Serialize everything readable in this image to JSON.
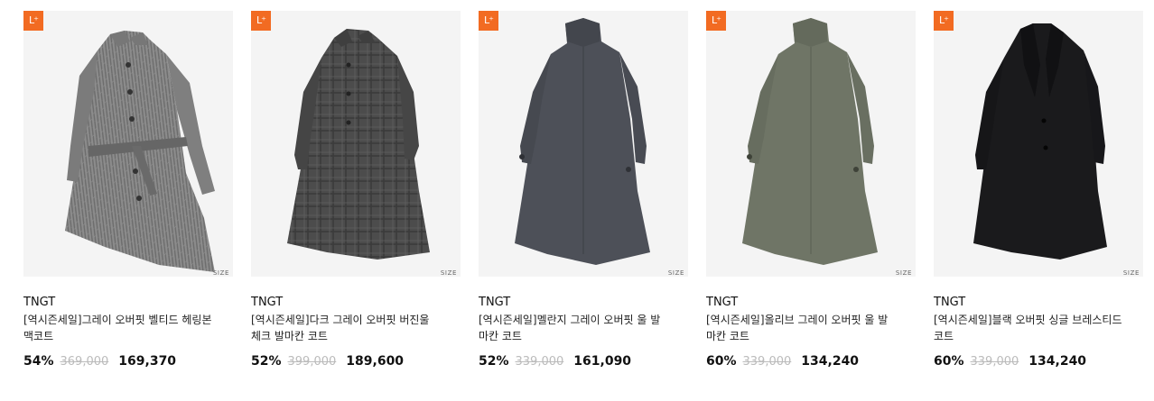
{
  "colors": {
    "badge_orange": "#f26b22",
    "thumb_bg": "#f4f4f4",
    "strike_gray": "#bbbbbb"
  },
  "products": [
    {
      "badge_icon": "l-plus-icon",
      "image": "gray-herringbone-belted-mac-coat",
      "coat_color": "#8a8a8a",
      "size_label": "SIZE",
      "brand": "TNGT",
      "name": "[역시즌세일]그레이 오버핏 벨티드 헤링본 맥코트",
      "discount": "54%",
      "original_price": "369,000",
      "sale_price": "169,370"
    },
    {
      "badge_icon": "l-plus-icon",
      "image": "dark-gray-check-balmacaan-coat",
      "coat_color": "#4a4a4a",
      "size_label": "SIZE",
      "brand": "TNGT",
      "name": "[역시즌세일]다크 그레이 오버핏 버진울 체크 발마칸 코트",
      "discount": "52%",
      "original_price": "399,000",
      "sale_price": "189,600"
    },
    {
      "badge_icon": "l-plus-icon",
      "image": "melange-gray-balmacaan-coat",
      "coat_color": "#4d5058",
      "size_label": "SIZE",
      "brand": "TNGT",
      "name": "[역시즌세일]멜란지 그레이 오버핏 울 발마칸 코트",
      "discount": "52%",
      "original_price": "339,000",
      "sale_price": "161,090"
    },
    {
      "badge_icon": "l-plus-icon",
      "image": "olive-gray-balmacaan-coat",
      "coat_color": "#6f7566",
      "size_label": "SIZE",
      "brand": "TNGT",
      "name": "[역시즌세일]올리브 그레이 오버핏 울 발마칸 코트",
      "discount": "60%",
      "original_price": "339,000",
      "sale_price": "134,240"
    },
    {
      "badge_icon": "l-plus-icon",
      "image": "black-single-breasted-coat",
      "coat_color": "#1a1a1c",
      "size_label": "SIZE",
      "brand": "TNGT",
      "name": "[역시즌세일]블랙 오버핏 싱글 브레스티드 코트",
      "discount": "60%",
      "original_price": "339,000",
      "sale_price": "134,240"
    }
  ]
}
